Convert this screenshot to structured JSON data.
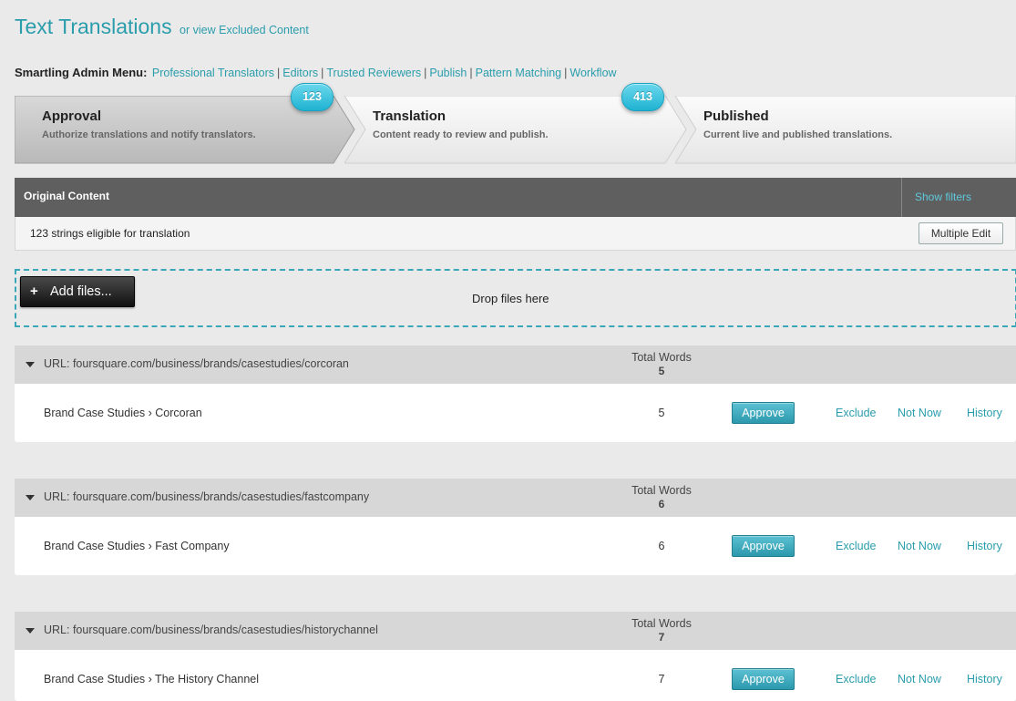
{
  "header": {
    "title": "Text Translations",
    "subtitle_link": "or view Excluded Content"
  },
  "admin_menu": {
    "label": "Smartling Admin Menu:",
    "links": [
      "Professional Translators",
      "Editors",
      "Trusted Reviewers",
      "Publish",
      "Pattern Matching",
      "Workflow"
    ]
  },
  "steps": [
    {
      "title": "Approval",
      "desc": "Authorize translations and notify translators.",
      "active": true
    },
    {
      "title": "Translation",
      "desc": "Content ready to review and publish."
    },
    {
      "title": "Published",
      "desc": "Current live and published translations."
    }
  ],
  "badges": [
    "123",
    "413"
  ],
  "colors": {
    "accent": "#2a9dac",
    "badge": "#28b8d8",
    "header_dark": "#5f5f5f"
  },
  "original_content": {
    "title": "Original Content",
    "show_filters": "Show filters",
    "count_text": "123 strings eligible for translation",
    "multiple_edit": "Multiple Edit"
  },
  "upload": {
    "button_icon": "plus-icon",
    "button_label": "Add files...",
    "drop_text": "Drop files here"
  },
  "groups": [
    {
      "url": "URL: foursquare.com/business/brands/casestudies/corcoran",
      "total_words_label": "Total Words",
      "total_words": "5",
      "item": "Brand Case Studies › Corcoran",
      "words": "5",
      "actions": {
        "approve": "Approve",
        "exclude": "Exclude",
        "not_now": "Not Now",
        "history": "History"
      }
    },
    {
      "url": "URL: foursquare.com/business/brands/casestudies/fastcompany",
      "total_words_label": "Total Words",
      "total_words": "6",
      "item": "Brand Case Studies › Fast Company",
      "words": "6",
      "actions": {
        "approve": "Approve",
        "exclude": "Exclude",
        "not_now": "Not Now",
        "history": "History"
      }
    },
    {
      "url": "URL: foursquare.com/business/brands/casestudies/historychannel",
      "total_words_label": "Total Words",
      "total_words": "7",
      "item": "Brand Case Studies › The History Channel",
      "words": "7",
      "actions": {
        "approve": "Approve",
        "exclude": "Exclude",
        "not_now": "Not Now",
        "history": "History"
      }
    }
  ]
}
